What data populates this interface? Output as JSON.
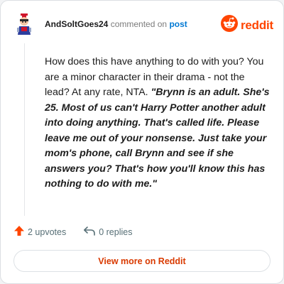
{
  "comment": {
    "username": "AndSoltGoes24",
    "action_text": "commented on",
    "post_link": "post",
    "body_plain": "How does this have anything to do with you? You are a minor character in their drama - not the lead? At any rate, NTA. ",
    "body_quote": "\"Brynn is an adult. She's 25. Most of us can't Harry Potter another adult into doing anything. That's called life. Please leave me out of your nonsense. Just take your mom's phone, call Brynn and see if she answers you? That's how you'll know this has nothing to do with me.\""
  },
  "brand": {
    "name": "reddit",
    "color": "#ff4500"
  },
  "stats": {
    "upvotes": "2 upvotes",
    "replies": "0 replies"
  },
  "footer": {
    "view_more": "View more on Reddit"
  },
  "colors": {
    "upvote": "#ff4500",
    "link": "#0079d3",
    "cta": "#d93a00"
  },
  "icons": {
    "avatar": "user-avatar-icon",
    "logo": "reddit-snoo-icon",
    "upvote": "upvote-arrow-icon",
    "reply": "reply-arrow-icon"
  }
}
